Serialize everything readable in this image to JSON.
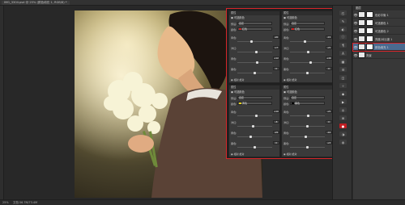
{
  "window": {
    "doc_tab_label": "IMG_3304.psd @ 25% (颜色填充 1, RGB/8) *"
  },
  "statusbar": {
    "zoom": "25%",
    "doc_info": "文档:36.7M/73.4M"
  },
  "layers": {
    "panel_title": "图层",
    "rows": [
      {
        "name": "色彩平衡 1"
      },
      {
        "name": "可选颜色 1"
      },
      {
        "name": "可选颜色 2"
      },
      {
        "name": "亮度/对比度 1"
      },
      {
        "name": "颜色填充 1"
      },
      {
        "name": "背景"
      }
    ],
    "selected_index": 4
  },
  "properties": [
    {
      "title": "属性",
      "header": "可选颜色",
      "preset_label": "预设:",
      "preset_value": "自定",
      "colors_label": "颜色:",
      "color_value": "红色",
      "color_swatch": "#c82828",
      "sliders": [
        {
          "label": "青色:",
          "value": "-20",
          "pos": 0.4
        },
        {
          "label": "洋红:",
          "value": "+7",
          "pos": 0.55
        },
        {
          "label": "黄色:",
          "value": "+12",
          "pos": 0.58
        },
        {
          "label": "黑色:",
          "value": "0",
          "pos": 0.5
        }
      ],
      "method": "相对  绝对"
    },
    {
      "title": "属性",
      "header": "可选颜色",
      "preset_label": "预设:",
      "preset_value": "自定",
      "colors_label": "颜色:",
      "color_value": "红色",
      "color_swatch": "#d82020",
      "sliders": [
        {
          "label": "青色:",
          "value": "-15",
          "pos": 0.42
        },
        {
          "label": "洋红:",
          "value": "+5",
          "pos": 0.53
        },
        {
          "label": "黄色:",
          "value": "+20",
          "pos": 0.6
        },
        {
          "label": "黑色:",
          "value": "0",
          "pos": 0.5
        }
      ],
      "method": "相对  绝对"
    },
    {
      "title": "属性",
      "header": "可选颜色",
      "preset_label": "预设:",
      "preset_value": "自定",
      "colors_label": "颜色:",
      "color_value": "黄色",
      "color_swatch": "#e6d21e",
      "sliders": [
        {
          "label": "青色:",
          "value": "+10",
          "pos": 0.55
        },
        {
          "label": "洋红:",
          "value": "-8",
          "pos": 0.46
        },
        {
          "label": "黄色:",
          "value": "-25",
          "pos": 0.38
        },
        {
          "label": "黑色:",
          "value": "0",
          "pos": 0.5
        }
      ],
      "method": "相对  绝对"
    },
    {
      "title": "属性",
      "header": "可选颜色",
      "preset_label": "预设:",
      "preset_value": "自定",
      "colors_label": "颜色:",
      "color_value": "黑色",
      "color_swatch": "#000000",
      "sliders": [
        {
          "label": "青色:",
          "value": "+5",
          "pos": 0.52
        },
        {
          "label": "洋红:",
          "value": "0",
          "pos": 0.5
        },
        {
          "label": "黄色:",
          "value": "-10",
          "pos": 0.45
        },
        {
          "label": "黑色:",
          "value": "+3",
          "pos": 0.51
        }
      ],
      "method": "相对  绝对"
    }
  ],
  "accent": "#d7262a"
}
